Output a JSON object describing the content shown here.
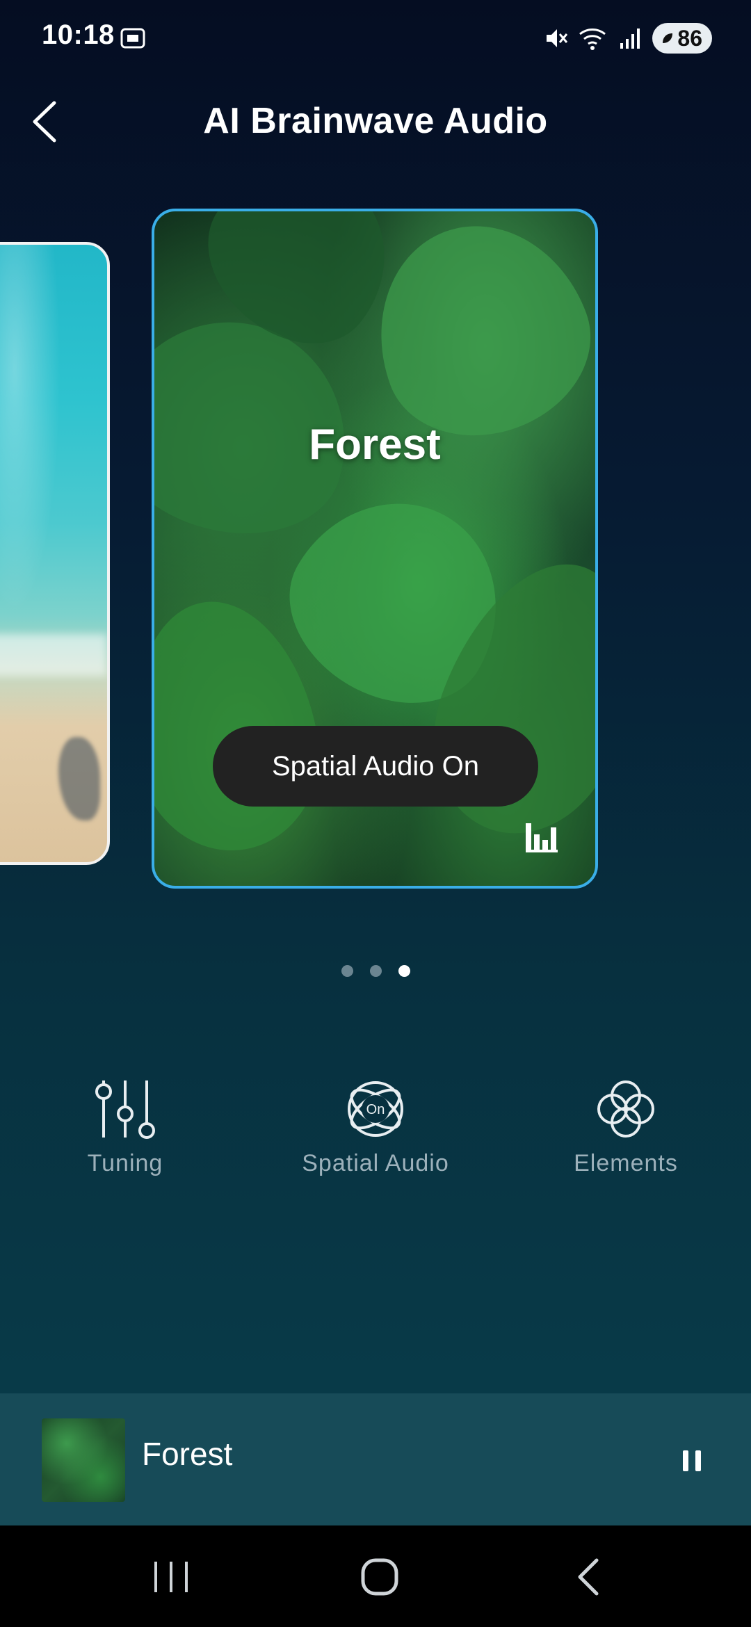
{
  "status_bar": {
    "time": "10:18",
    "battery": "86"
  },
  "header": {
    "title": "AI Brainwave Audio"
  },
  "carousel": {
    "current_card": {
      "title": "Forest",
      "toast": "Spatial Audio On"
    },
    "page_count": 3,
    "active_page": 3
  },
  "controls": {
    "tuning_label": "Tuning",
    "spatial_label": "Spatial Audio",
    "spatial_state": "On",
    "elements_label": "Elements"
  },
  "mini_player": {
    "title": "Forest"
  }
}
